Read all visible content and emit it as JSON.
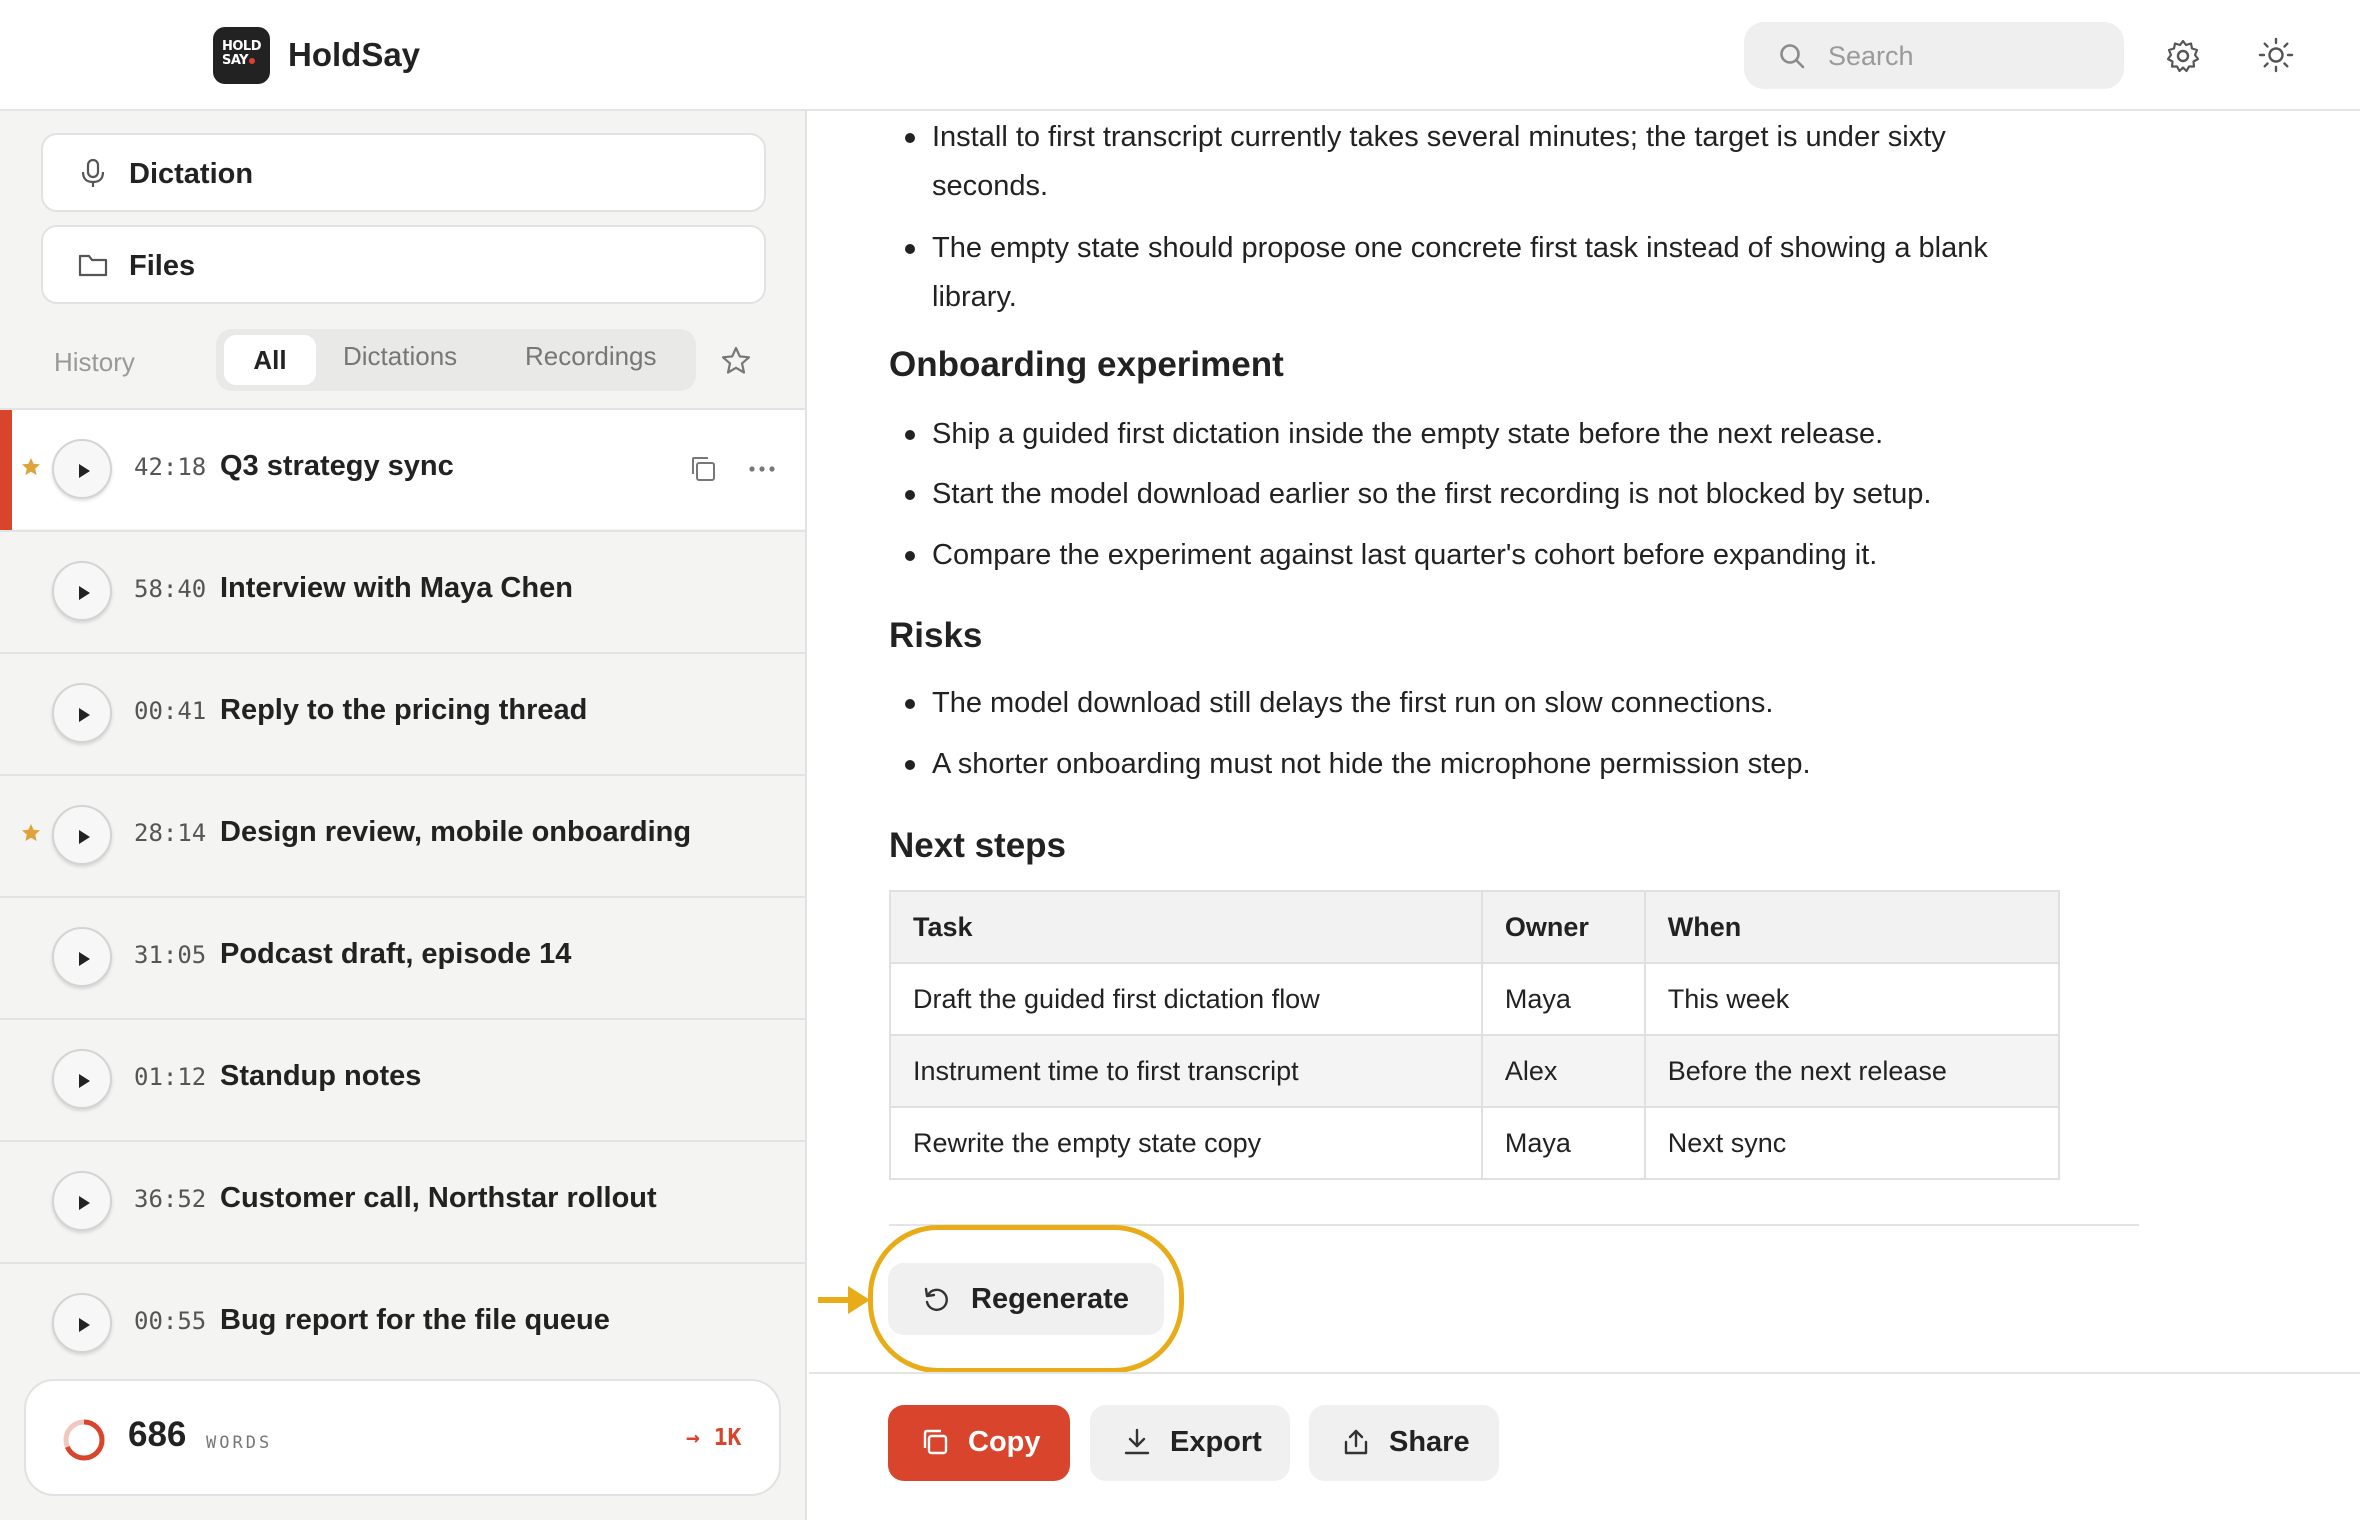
{
  "app": {
    "logo_text_1": "HOLD",
    "logo_text_2": "SAY",
    "name": "HoldSay"
  },
  "search": {
    "placeholder": "Search"
  },
  "sidebar": {
    "nav": [
      {
        "label": "Dictation",
        "icon": "microphone-icon"
      },
      {
        "label": "Files",
        "icon": "folder-icon"
      }
    ],
    "history_label": "History",
    "filters": [
      "All",
      "Dictations",
      "Recordings"
    ],
    "active_filter": "All",
    "items": [
      {
        "duration": "42:18",
        "title": "Q3 strategy sync",
        "starred": true,
        "active": true
      },
      {
        "duration": "58:40",
        "title": "Interview with Maya Chen",
        "starred": false,
        "active": false
      },
      {
        "duration": "00:41",
        "title": "Reply to the pricing thread",
        "starred": false,
        "active": false
      },
      {
        "duration": "28:14",
        "title": "Design review, mobile onboarding",
        "starred": true,
        "active": false
      },
      {
        "duration": "31:05",
        "title": "Podcast draft, episode 14",
        "starred": false,
        "active": false
      },
      {
        "duration": "01:12",
        "title": "Standup notes",
        "starred": false,
        "active": false
      },
      {
        "duration": "36:52",
        "title": "Customer call, Northstar rollout",
        "starred": false,
        "active": false
      },
      {
        "duration": "00:55",
        "title": "Bug report for the file queue",
        "starred": false,
        "active": false
      }
    ],
    "word_count": {
      "value": "686",
      "unit": "WORDS",
      "goal": "→ 1K",
      "progress": 0.686
    }
  },
  "content": {
    "intro_bullets": [
      "Install to first transcript currently takes several minutes; the target is under sixty seconds.",
      "The empty state should propose one concrete first task instead of showing a blank library."
    ],
    "sections": [
      {
        "heading": "Onboarding experiment",
        "bullets": [
          "Ship a guided first dictation inside the empty state before the next release.",
          "Start the model download earlier so the first recording is not blocked by setup.",
          "Compare the experiment against last quarter's cohort before expanding it."
        ]
      },
      {
        "heading": "Risks",
        "bullets": [
          "The model download still delays the first run on slow connections.",
          "A shorter onboarding must not hide the microphone permission step."
        ]
      }
    ],
    "next_steps": {
      "heading": "Next steps",
      "columns": [
        "Task",
        "Owner",
        "When"
      ],
      "rows": [
        [
          "Draft the guided first dictation flow",
          "Maya",
          "This week"
        ],
        [
          "Instrument time to first transcript",
          "Alex",
          "Before the next release"
        ],
        [
          "Rewrite the empty state copy",
          "Maya",
          "Next sync"
        ]
      ]
    },
    "regenerate_label": "Regenerate"
  },
  "actions": {
    "copy": "Copy",
    "export": "Export",
    "share": "Share"
  },
  "colors": {
    "accent": "#d9442c",
    "highlight": "#e7ac17",
    "star": "#e0a23a"
  }
}
